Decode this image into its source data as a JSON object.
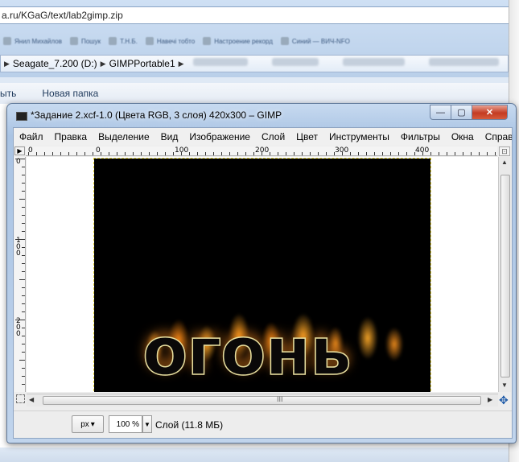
{
  "background": {
    "url": "a.ru/KGaG/text/lab2gimp.zip",
    "bookmarks": [
      "Янил Михайлов",
      "Пошук",
      "Т.Н.Б.",
      "Навечі тобто",
      "Настроение рекорд",
      "Синий — ВИЧ-NFO"
    ],
    "path": [
      "Seagate_7.200 (D:)",
      "GIMPPortable1"
    ],
    "commands": [
      "ыть",
      "Новая папка"
    ]
  },
  "window": {
    "title": "*Задание 2.xcf-1.0 (Цвета RGB, 3 слоя) 420x300 – GIMP",
    "min_glyph": "—",
    "max_glyph": "▢",
    "close_glyph": "✕"
  },
  "menu": [
    "Файл",
    "Правка",
    "Выделение",
    "Вид",
    "Изображение",
    "Слой",
    "Цвет",
    "Инструменты",
    "Фильтры",
    "Окна",
    "Справка"
  ],
  "rulers": {
    "h_labels": [
      "0",
      "0",
      "100",
      "200",
      "300",
      "400"
    ],
    "v_labels": [
      "0",
      "1\n0\n0",
      "2\n0\n0"
    ]
  },
  "image": {
    "text": "огонь",
    "selection_color": "#e3d43b",
    "fire_color": "#ffa020"
  },
  "scrollbar": {
    "grip": "III"
  },
  "status": {
    "unit": "px",
    "zoom": "100 %",
    "layer_info": "Слой (11.8 МБ)"
  }
}
